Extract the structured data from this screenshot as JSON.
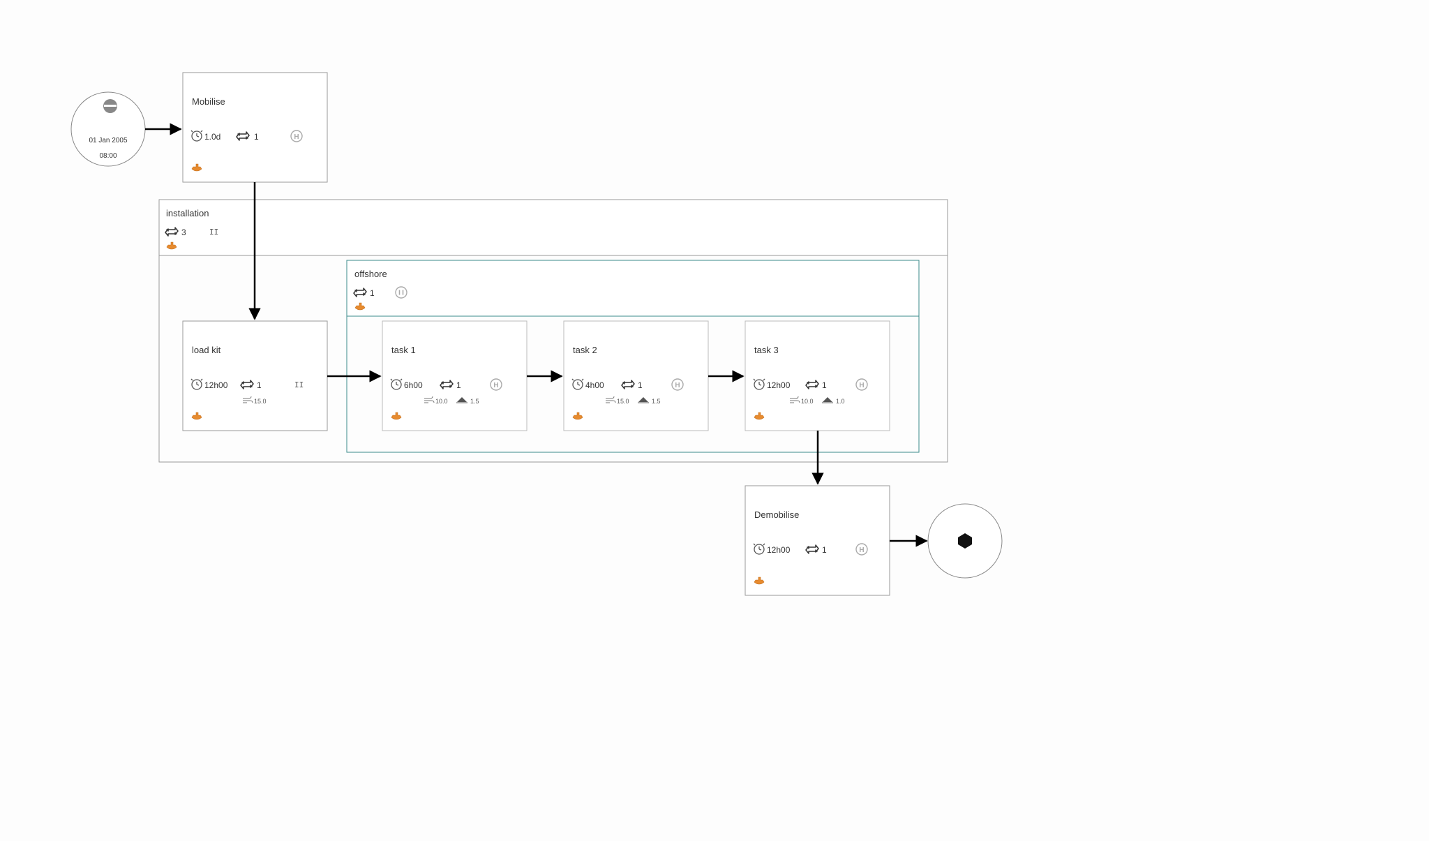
{
  "start": {
    "date": "01 Jan 2005",
    "time": "08:00"
  },
  "mobilise": {
    "title": "Mobilise",
    "duration": "1.0d",
    "repeat": "1"
  },
  "installation": {
    "title": "installation",
    "repeat": "3"
  },
  "offshore": {
    "title": "offshore",
    "repeat": "1"
  },
  "loadkit": {
    "title": "load kit",
    "duration": "12h00",
    "repeat": "1",
    "param1": "15.0"
  },
  "task1": {
    "title": "task 1",
    "duration": "6h00",
    "repeat": "1",
    "param1": "10.0",
    "param2": "1.5"
  },
  "task2": {
    "title": "task 2",
    "duration": "4h00",
    "repeat": "1",
    "param1": "15.0",
    "param2": "1.5"
  },
  "task3": {
    "title": "task 3",
    "duration": "12h00",
    "repeat": "1",
    "param1": "10.0",
    "param2": "1.0"
  },
  "demobilise": {
    "title": "Demobilise",
    "duration": "12h00",
    "repeat": "1"
  }
}
